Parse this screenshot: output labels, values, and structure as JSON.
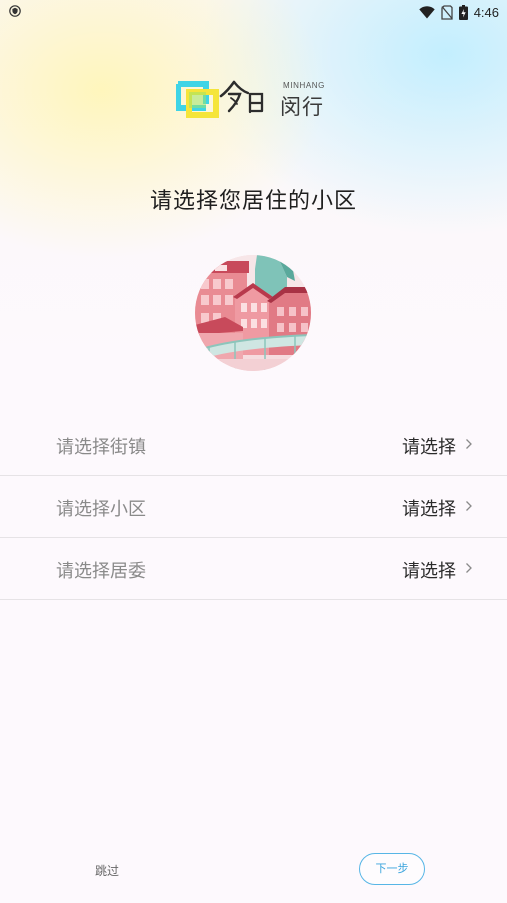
{
  "status_bar": {
    "time": "4:46",
    "icons": [
      "shield-icon",
      "wifi-icon",
      "no-sim-icon",
      "battery-charging-icon"
    ]
  },
  "logo": {
    "brand_sub": "MINHANG",
    "brand_main": "闵行"
  },
  "title": "请选择您居住的小区",
  "rows": [
    {
      "label": "请选择街镇",
      "value": "请选择"
    },
    {
      "label": "请选择小区",
      "value": "请选择"
    },
    {
      "label": "请选择居委",
      "value": "请选择"
    }
  ],
  "footer": {
    "skip": "跳过",
    "next": "下一步"
  },
  "colors": {
    "accent": "#3aa4dd",
    "logo_cyan": "#3fd4e6",
    "logo_yellow": "#f5e53a"
  }
}
